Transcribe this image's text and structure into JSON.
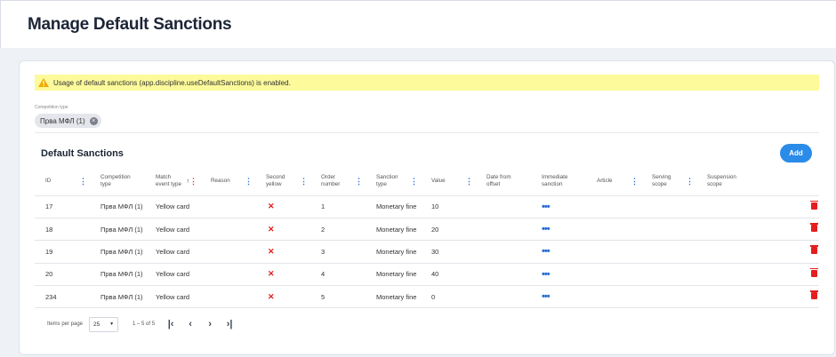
{
  "page": {
    "title": "Manage Default Sanctions"
  },
  "alert": {
    "text": "Usage of default sanctions (app.discipline.useDefaultSanctions) is enabled."
  },
  "filter": {
    "label": "Competition type",
    "chip": "Прва МФЛ (1)"
  },
  "section": {
    "title": "Default Sanctions",
    "add_label": "Add"
  },
  "table": {
    "columns": [
      {
        "key": "id",
        "label": "ID",
        "kebab": true
      },
      {
        "key": "competition",
        "label": "Competition type",
        "kebab": false
      },
      {
        "key": "match_event",
        "label": "Match event type",
        "kebab": true,
        "sorted": true
      },
      {
        "key": "reason",
        "label": "Reason",
        "kebab": true
      },
      {
        "key": "second_yellow",
        "label": "Second yellow",
        "kebab": true
      },
      {
        "key": "order",
        "label": "Order number",
        "kebab": true
      },
      {
        "key": "sanction_type",
        "label": "Sanction type",
        "kebab": true
      },
      {
        "key": "value",
        "label": "Value",
        "kebab": true
      },
      {
        "key": "date_offset",
        "label": "Date from offset",
        "kebab": false
      },
      {
        "key": "immediate",
        "label": "Immediate sanction",
        "kebab": false
      },
      {
        "key": "article",
        "label": "Article",
        "kebab": true
      },
      {
        "key": "serving",
        "label": "Serving scope",
        "kebab": true
      },
      {
        "key": "suspension",
        "label": "Suspension scope",
        "kebab": false
      },
      {
        "key": "actions",
        "label": "",
        "kebab": false
      }
    ],
    "rows": [
      {
        "id": "17",
        "competition": "Прва МФЛ (1)",
        "match_event": "Yellow card",
        "order": "1",
        "sanction_type": "Monetary fine",
        "value": "10"
      },
      {
        "id": "18",
        "competition": "Прва МФЛ (1)",
        "match_event": "Yellow card",
        "order": "2",
        "sanction_type": "Monetary fine",
        "value": "20"
      },
      {
        "id": "19",
        "competition": "Прва МФЛ (1)",
        "match_event": "Yellow card",
        "order": "3",
        "sanction_type": "Monetary fine",
        "value": "30"
      },
      {
        "id": "20",
        "competition": "Прва МФЛ (1)",
        "match_event": "Yellow card",
        "order": "4",
        "sanction_type": "Monetary fine",
        "value": "40"
      },
      {
        "id": "234",
        "competition": "Прва МФЛ (1)",
        "match_event": "Yellow card",
        "order": "5",
        "sanction_type": "Monetary fine",
        "value": "0"
      }
    ],
    "second_yellow_glyph": "✕",
    "immediate_glyph": "•••"
  },
  "pagination": {
    "items_per_page_label": "Items per page",
    "page_size": "25",
    "range": "1 – 5 of 5"
  },
  "colors": {
    "accent": "#2a8be8",
    "alert_bg": "#fcfa9a",
    "danger": "#e41e1e"
  }
}
